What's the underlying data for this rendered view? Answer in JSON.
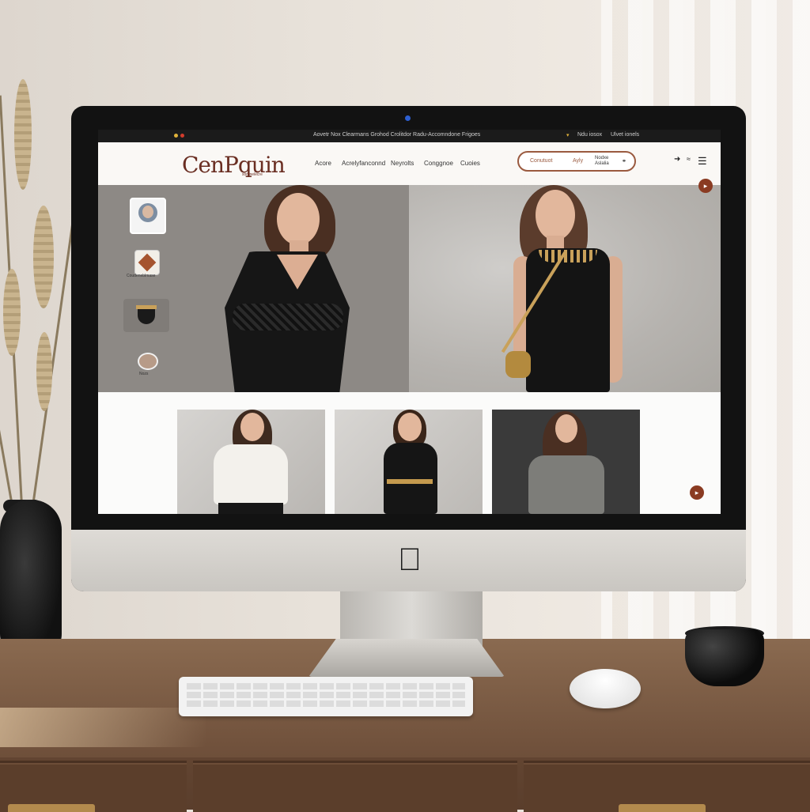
{
  "topbar": {
    "center_text": "Aovetr Nox  Clearmans Grohod Crolitdor  Radu-Accomndone Frigoes",
    "right_a": "▾",
    "right_b": "Ndu  iosox",
    "right_c": "Ulvet  ionels"
  },
  "brand": {
    "logo_text": "CenPquin",
    "logo_sub": "somnelecre"
  },
  "nav": [
    "Acore",
    "Acrelyfanconnd",
    "Neyrolts",
    "Conggnoe",
    "Cuoies"
  ],
  "search_pill": {
    "left": "Conutuot",
    "mid": "Ayly",
    "right": "Nodxe Aslalia"
  },
  "thumbnails": [
    {
      "caption": ""
    },
    {
      "caption": "Coudeneblmase"
    },
    {
      "caption": ""
    },
    {
      "caption": "Nozs"
    }
  ],
  "icons": {
    "link": "link-icon",
    "arrow": "arrow-icon",
    "wifi": "wifi-icon",
    "menu": "hamburger-menu-icon",
    "apple": "apple-logo-icon"
  },
  "colors": {
    "accent": "#8a3b22",
    "brand": "#6a2e22",
    "topbar": "#1b1b1b"
  }
}
